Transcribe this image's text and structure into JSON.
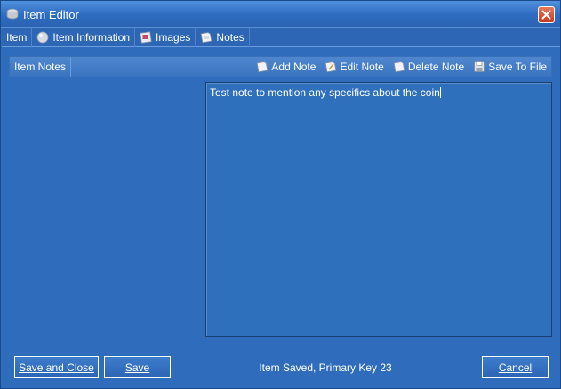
{
  "window": {
    "title": "Item Editor",
    "title_icon": "coins-icon"
  },
  "tabs": [
    {
      "label": "Item",
      "icon": ""
    },
    {
      "label": "Item Information",
      "icon": "info-disc-icon"
    },
    {
      "label": "Images",
      "icon": "image-icon"
    },
    {
      "label": "Notes",
      "icon": "note-icon"
    }
  ],
  "notes_toolbar": {
    "label": "Item Notes",
    "buttons": [
      {
        "label": "Add Note",
        "icon": "note-add-icon"
      },
      {
        "label": "Edit Note",
        "icon": "note-edit-icon"
      },
      {
        "label": "Delete Note",
        "icon": "note-delete-icon"
      },
      {
        "label": "Save To File",
        "icon": "floppy-disk-icon"
      }
    ]
  },
  "note": {
    "text": "Test note to mention any specifics about the coin"
  },
  "footer": {
    "save_close_label": "Save and Close",
    "save_label": "Save",
    "status": "Item Saved, Primary Key 23",
    "cancel_label": "Cancel"
  },
  "colors": {
    "background": "#2f6cbc",
    "close_button": "#c73a1e"
  }
}
